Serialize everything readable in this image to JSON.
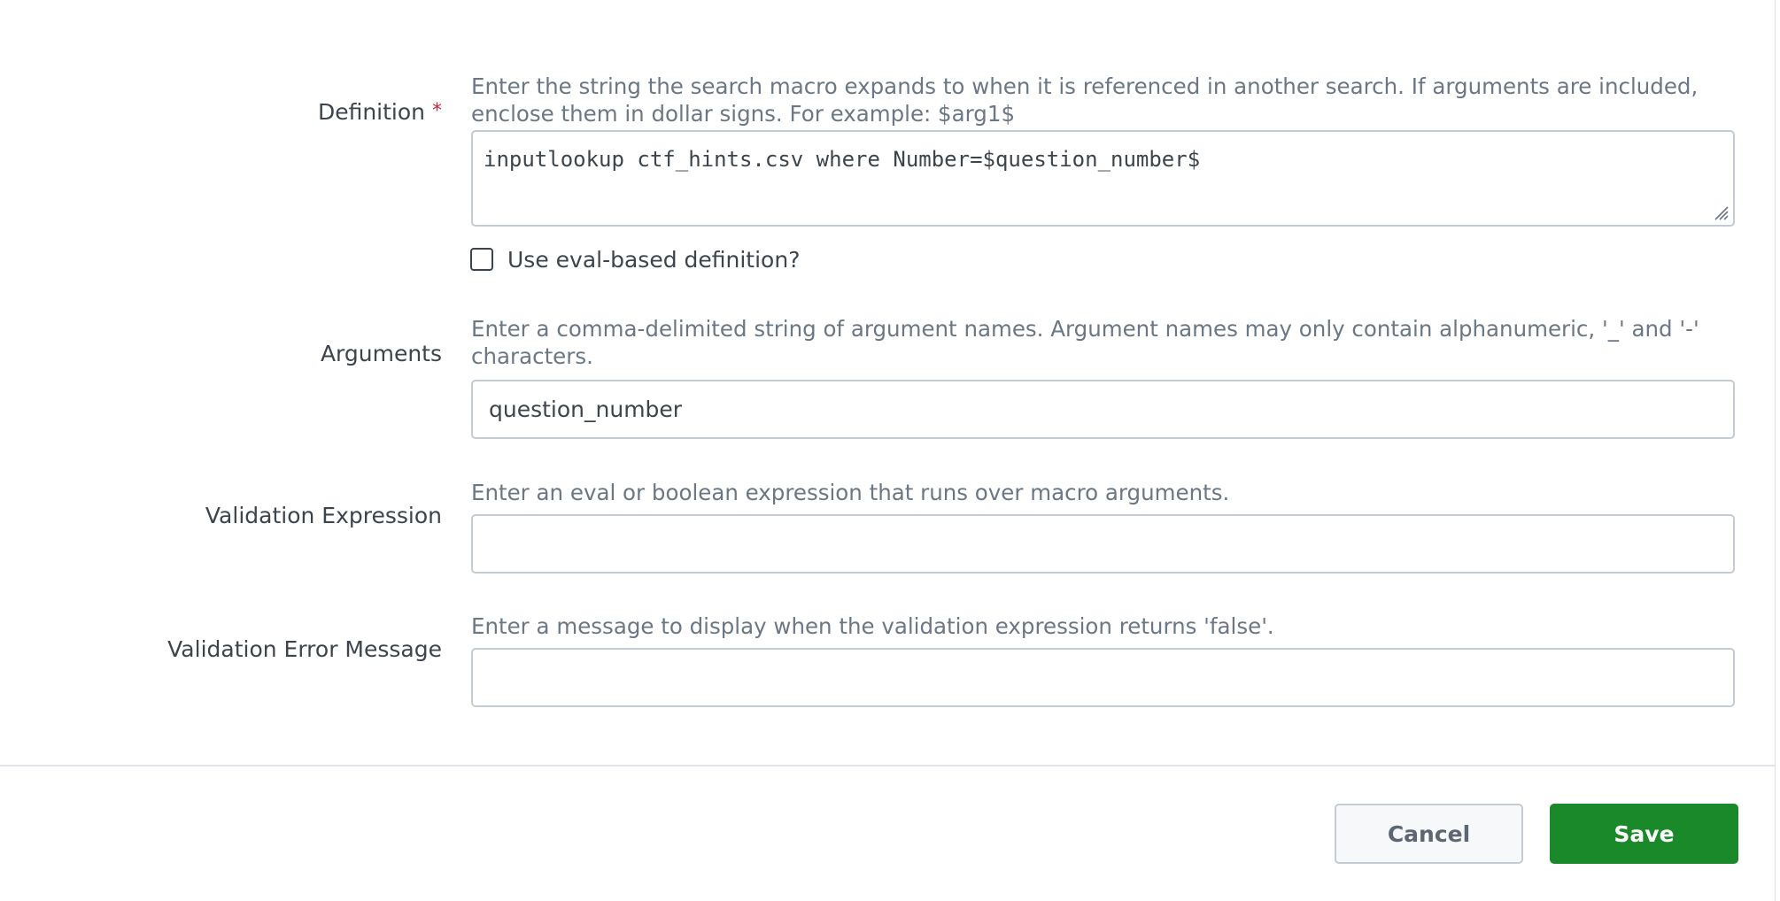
{
  "form": {
    "definition": {
      "label": "Definition",
      "required_marker": "*",
      "help": "Enter the string the search macro expands to when it is referenced in another search. If arguments are included, enclose them in dollar signs. For example: $arg1$",
      "value": "inputlookup ctf_hints.csv where Number=$question_number$"
    },
    "eval_checkbox": {
      "label": "Use eval-based definition?",
      "checked": false
    },
    "arguments": {
      "label": "Arguments",
      "help": "Enter a comma-delimited string of argument names. Argument names may only contain alphanumeric, '_' and '-' characters.",
      "value": "question_number"
    },
    "validation_expression": {
      "label": "Validation Expression",
      "help": "Enter an eval or boolean expression that runs over macro arguments.",
      "value": ""
    },
    "validation_error_message": {
      "label": "Validation Error Message",
      "help": "Enter a message to display when the validation expression returns 'false'.",
      "value": ""
    }
  },
  "footer": {
    "cancel_label": "Cancel",
    "save_label": "Save"
  },
  "colors": {
    "save_button": "#1a8929",
    "required_marker": "#c5273a",
    "help_text": "#6b7785",
    "label_text": "#3c444d"
  },
  "icons": {
    "textarea_resize": "resize-grip-icon"
  }
}
